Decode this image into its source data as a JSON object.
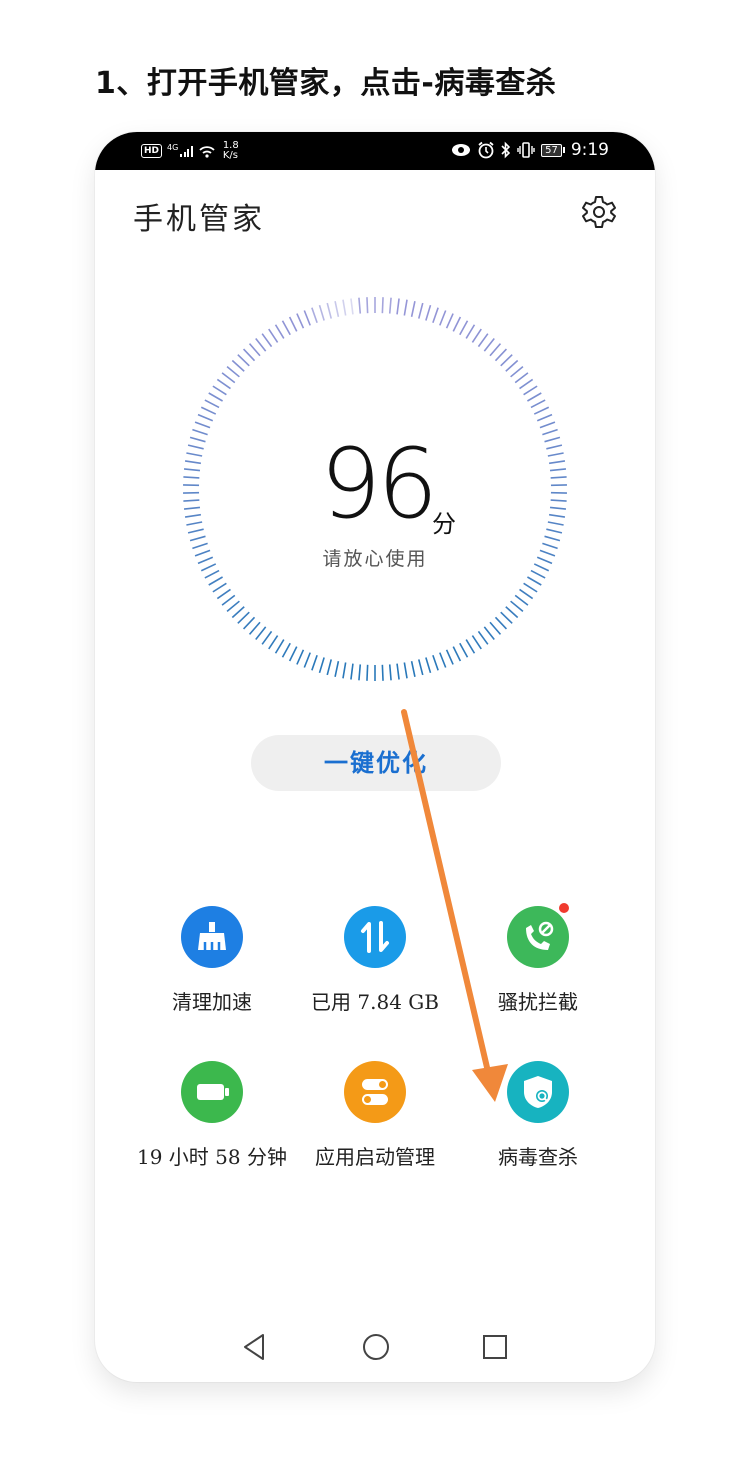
{
  "step_title": "1、打开手机管家，点击-病毒查杀",
  "statusbar": {
    "hd": "HD",
    "network": "4G",
    "speed_value": "1.8",
    "speed_unit": "K/s",
    "battery": "57",
    "time": "9:19"
  },
  "app": {
    "title": "手机管家"
  },
  "score": {
    "value": "96",
    "unit": "分",
    "subtitle": "请放心使用"
  },
  "optimize_button": "一键优化",
  "tools": [
    {
      "label": "清理加速",
      "icon": "broom-icon",
      "color": "#1e7fe3"
    },
    {
      "label": "已用 7.84 GB",
      "icon": "data-transfer-icon",
      "color": "#1a9be8"
    },
    {
      "label": "骚扰拦截",
      "icon": "phone-block-icon",
      "color": "#3db85a"
    },
    {
      "label": "19 小时 58 分钟",
      "icon": "battery-icon",
      "color": "#3cb84d"
    },
    {
      "label": "应用启动管理",
      "icon": "toggle-icon",
      "color": "#f49a17"
    },
    {
      "label": "病毒查杀",
      "icon": "shield-scan-icon",
      "color": "#17b3c0"
    }
  ],
  "annotation_color": "#f0883a"
}
